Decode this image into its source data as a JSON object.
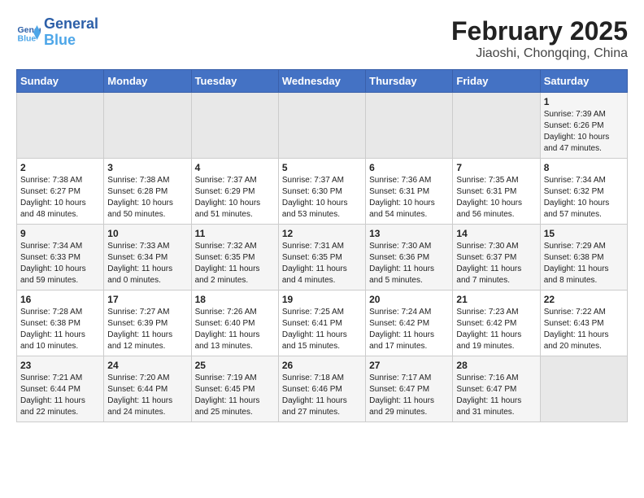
{
  "logo": {
    "text_general": "General",
    "text_blue": "Blue"
  },
  "title": "February 2025",
  "subtitle": "Jiaoshi, Chongqing, China",
  "days_of_week": [
    "Sunday",
    "Monday",
    "Tuesday",
    "Wednesday",
    "Thursday",
    "Friday",
    "Saturday"
  ],
  "weeks": [
    [
      {
        "day": "",
        "info": "",
        "empty": true
      },
      {
        "day": "",
        "info": "",
        "empty": true
      },
      {
        "day": "",
        "info": "",
        "empty": true
      },
      {
        "day": "",
        "info": "",
        "empty": true
      },
      {
        "day": "",
        "info": "",
        "empty": true
      },
      {
        "day": "",
        "info": "",
        "empty": true
      },
      {
        "day": "1",
        "info": "Sunrise: 7:39 AM\nSunset: 6:26 PM\nDaylight: 10 hours and 47 minutes."
      }
    ],
    [
      {
        "day": "2",
        "info": "Sunrise: 7:38 AM\nSunset: 6:27 PM\nDaylight: 10 hours and 48 minutes."
      },
      {
        "day": "3",
        "info": "Sunrise: 7:38 AM\nSunset: 6:28 PM\nDaylight: 10 hours and 50 minutes."
      },
      {
        "day": "4",
        "info": "Sunrise: 7:37 AM\nSunset: 6:29 PM\nDaylight: 10 hours and 51 minutes."
      },
      {
        "day": "5",
        "info": "Sunrise: 7:37 AM\nSunset: 6:30 PM\nDaylight: 10 hours and 53 minutes."
      },
      {
        "day": "6",
        "info": "Sunrise: 7:36 AM\nSunset: 6:31 PM\nDaylight: 10 hours and 54 minutes."
      },
      {
        "day": "7",
        "info": "Sunrise: 7:35 AM\nSunset: 6:31 PM\nDaylight: 10 hours and 56 minutes."
      },
      {
        "day": "8",
        "info": "Sunrise: 7:34 AM\nSunset: 6:32 PM\nDaylight: 10 hours and 57 minutes."
      }
    ],
    [
      {
        "day": "9",
        "info": "Sunrise: 7:34 AM\nSunset: 6:33 PM\nDaylight: 10 hours and 59 minutes."
      },
      {
        "day": "10",
        "info": "Sunrise: 7:33 AM\nSunset: 6:34 PM\nDaylight: 11 hours and 0 minutes."
      },
      {
        "day": "11",
        "info": "Sunrise: 7:32 AM\nSunset: 6:35 PM\nDaylight: 11 hours and 2 minutes."
      },
      {
        "day": "12",
        "info": "Sunrise: 7:31 AM\nSunset: 6:35 PM\nDaylight: 11 hours and 4 minutes."
      },
      {
        "day": "13",
        "info": "Sunrise: 7:30 AM\nSunset: 6:36 PM\nDaylight: 11 hours and 5 minutes."
      },
      {
        "day": "14",
        "info": "Sunrise: 7:30 AM\nSunset: 6:37 PM\nDaylight: 11 hours and 7 minutes."
      },
      {
        "day": "15",
        "info": "Sunrise: 7:29 AM\nSunset: 6:38 PM\nDaylight: 11 hours and 8 minutes."
      }
    ],
    [
      {
        "day": "16",
        "info": "Sunrise: 7:28 AM\nSunset: 6:38 PM\nDaylight: 11 hours and 10 minutes."
      },
      {
        "day": "17",
        "info": "Sunrise: 7:27 AM\nSunset: 6:39 PM\nDaylight: 11 hours and 12 minutes."
      },
      {
        "day": "18",
        "info": "Sunrise: 7:26 AM\nSunset: 6:40 PM\nDaylight: 11 hours and 13 minutes."
      },
      {
        "day": "19",
        "info": "Sunrise: 7:25 AM\nSunset: 6:41 PM\nDaylight: 11 hours and 15 minutes."
      },
      {
        "day": "20",
        "info": "Sunrise: 7:24 AM\nSunset: 6:42 PM\nDaylight: 11 hours and 17 minutes."
      },
      {
        "day": "21",
        "info": "Sunrise: 7:23 AM\nSunset: 6:42 PM\nDaylight: 11 hours and 19 minutes."
      },
      {
        "day": "22",
        "info": "Sunrise: 7:22 AM\nSunset: 6:43 PM\nDaylight: 11 hours and 20 minutes."
      }
    ],
    [
      {
        "day": "23",
        "info": "Sunrise: 7:21 AM\nSunset: 6:44 PM\nDaylight: 11 hours and 22 minutes."
      },
      {
        "day": "24",
        "info": "Sunrise: 7:20 AM\nSunset: 6:44 PM\nDaylight: 11 hours and 24 minutes."
      },
      {
        "day": "25",
        "info": "Sunrise: 7:19 AM\nSunset: 6:45 PM\nDaylight: 11 hours and 25 minutes."
      },
      {
        "day": "26",
        "info": "Sunrise: 7:18 AM\nSunset: 6:46 PM\nDaylight: 11 hours and 27 minutes."
      },
      {
        "day": "27",
        "info": "Sunrise: 7:17 AM\nSunset: 6:47 PM\nDaylight: 11 hours and 29 minutes."
      },
      {
        "day": "28",
        "info": "Sunrise: 7:16 AM\nSunset: 6:47 PM\nDaylight: 11 hours and 31 minutes."
      },
      {
        "day": "",
        "info": "",
        "empty": true
      }
    ]
  ]
}
